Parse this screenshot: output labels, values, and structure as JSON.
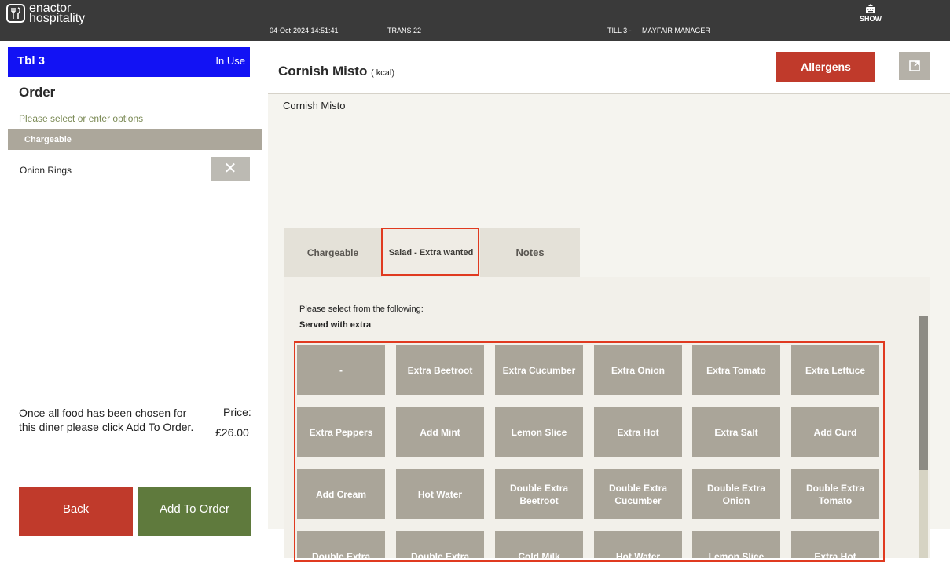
{
  "app": {
    "logo_line1": "enactor",
    "logo_line2": "hospitality"
  },
  "topbar": {
    "datetime": "04-Oct-2024 14:51:41",
    "trans": "TRANS 22",
    "till": "TILL 3 -",
    "user": "MAYFAIR MANAGER",
    "keyboard_label": "SHOW"
  },
  "sidebar": {
    "table": "Tbl 3",
    "table_status": "In Use",
    "order_title": "Order",
    "subtitle": "Please select or enter options",
    "section": "Chargeable",
    "items": [
      {
        "name": "Onion Rings"
      }
    ],
    "remove_glyph": "✕",
    "info": "Once all food has been chosen for this diner please click Add To Order.",
    "price_label": "Price:",
    "price": "£26.00",
    "back_label": "Back",
    "add_label": "Add To Order"
  },
  "product": {
    "name": "Cornish Misto",
    "kcal": "( kcal)",
    "description": "Cornish Misto",
    "allergens_label": "Allergens"
  },
  "tabs": [
    {
      "label": "Chargeable",
      "selected": false
    },
    {
      "label": "Salad - Extra wanted",
      "selected": true
    },
    {
      "label": "Notes",
      "selected": false
    }
  ],
  "prompt": "Please select from the following:",
  "group": "Served with extra",
  "options": [
    "-",
    "Extra Beetroot",
    "Extra Cucumber",
    "Extra Onion",
    "Extra Tomato",
    "Extra Lettuce",
    "Extra Peppers",
    "Add Mint",
    "Lemon Slice",
    "Extra Hot",
    "Extra Salt",
    "Add Curd",
    "Add Cream",
    "Hot Water",
    "Double Extra Beetroot",
    "Double Extra Cucumber",
    "Double Extra Onion",
    "Double Extra Tomato",
    "Double Extra",
    "Double Extra",
    "Cold Milk",
    "Hot Water",
    "Lemon Slice",
    "Extra Hot"
  ],
  "colors": {
    "accent_blue": "#1212f4",
    "danger_red": "#c03a2b",
    "confirm_green": "#5f7a3d",
    "option_bg": "#aaa599",
    "highlight": "#e03a20"
  }
}
